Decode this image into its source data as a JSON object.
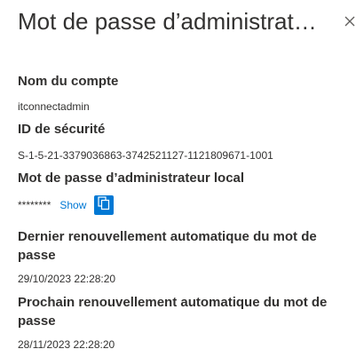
{
  "panel": {
    "title": "Mot de passe d’administrateu...",
    "close_icon": "close-icon"
  },
  "fields": {
    "account_name_label": "Nom du compte",
    "account_name_value": "itconnectadmin",
    "security_id_label": "ID de sécurité",
    "security_id_value": "S-1-5-21-3379036863-3742521127-1121809671-1001",
    "local_admin_password_label": "Mot de passe d’administrateur local",
    "password_mask": "********",
    "show_label": "Show",
    "copy_icon": "copy-icon",
    "last_rotation_label": "Dernier renouvellement automatique du mot de passe",
    "last_rotation_value": "29/10/2023 22:28:20",
    "next_rotation_label": "Prochain renouvellement automatique du mot de passe",
    "next_rotation_value": "28/11/2023 22:28:20"
  },
  "colors": {
    "accent": "#0078d4",
    "text": "#323130"
  }
}
